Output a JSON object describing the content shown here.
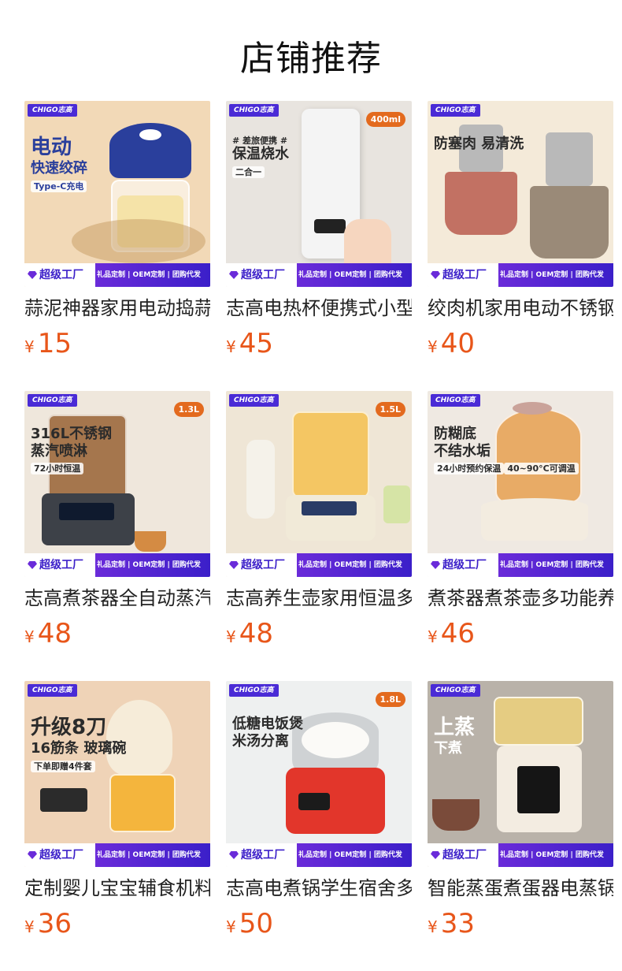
{
  "header": {
    "title": "店铺推荐"
  },
  "footer_badge": {
    "factory": "超级工厂",
    "services": "礼品定制 | OEM定制 | 团购代发",
    "brand": "CHIGO志高"
  },
  "currency": "¥",
  "products": [
    {
      "name": "蒜泥神器家用电动捣蒜机",
      "price": "15",
      "promo_line1": "电动",
      "promo_line2": "快速绞碎",
      "promo_line3": "Type-C充电",
      "icon": "food-chopper-icon",
      "bg": "#f2d9b7",
      "accent": "#2a3f9c"
    },
    {
      "name": "志高电热杯便携式小型烧水杯",
      "price": "45",
      "promo_line1": "# 差旅便携 #",
      "promo_line2": "保温烧水",
      "promo_line3": "二合一",
      "badge": "400ml",
      "icon": "travel-kettle-icon",
      "bg": "#e8e4df",
      "accent": "#f4f4f4"
    },
    {
      "name": "绞肉机家用电动不锈钢",
      "price": "40",
      "promo_line1": "防塞肉 易清洗",
      "icon": "meat-grinder-icon",
      "bg": "#f4ead9",
      "accent": "#b9b9b9"
    },
    {
      "name": "志高煮茶器全自动蒸汽煮茶壶",
      "price": "48",
      "promo_line1": "316L不锈钢",
      "promo_line2": "蒸汽喷淋",
      "promo_line3": "72小时恒温",
      "badge": "1.3L",
      "icon": "tea-maker-icon",
      "bg": "#efe7dc",
      "accent": "#3d4148"
    },
    {
      "name": "志高养生壶家用恒温多功能",
      "price": "48",
      "badge": "1.5L",
      "icon": "health-kettle-icon",
      "bg": "#efe6d6",
      "accent": "#f1ead8"
    },
    {
      "name": "煮茶器煮茶壶多功能养生壶",
      "price": "46",
      "promo_line1": "防糊底",
      "promo_line2": "不结水垢",
      "promo_line3": "24小时预约保温",
      "promo_line4": "40~90°C可调温",
      "icon": "glass-kettle-icon",
      "bg": "#efe9e2",
      "accent": "#f3ece0"
    },
    {
      "name": "定制婴儿宝宝辅食机料理机",
      "price": "36",
      "promo_line1": "升级8刀",
      "promo_line2": "16筋条 玻璃碗",
      "promo_line3": "下单即赠4件套",
      "icon": "baby-food-maker-icon",
      "bg": "#efd3b7",
      "accent": "#f6ecd9"
    },
    {
      "name": "志高电煮锅学生宿舍多功能",
      "price": "50",
      "promo_line1": "低糖电饭煲",
      "promo_line2": "米汤分离",
      "badge": "1.8L",
      "icon": "electric-cooker-icon",
      "bg": "#eef0f0",
      "accent": "#e2362b"
    },
    {
      "name": "智能蒸蛋煮蛋器电蒸锅家用",
      "price": "33",
      "promo_line1": "上蒸",
      "promo_line2": "下煮",
      "icon": "egg-steamer-icon",
      "bg": "#b9b2a9",
      "accent": "#f3ece1"
    }
  ]
}
